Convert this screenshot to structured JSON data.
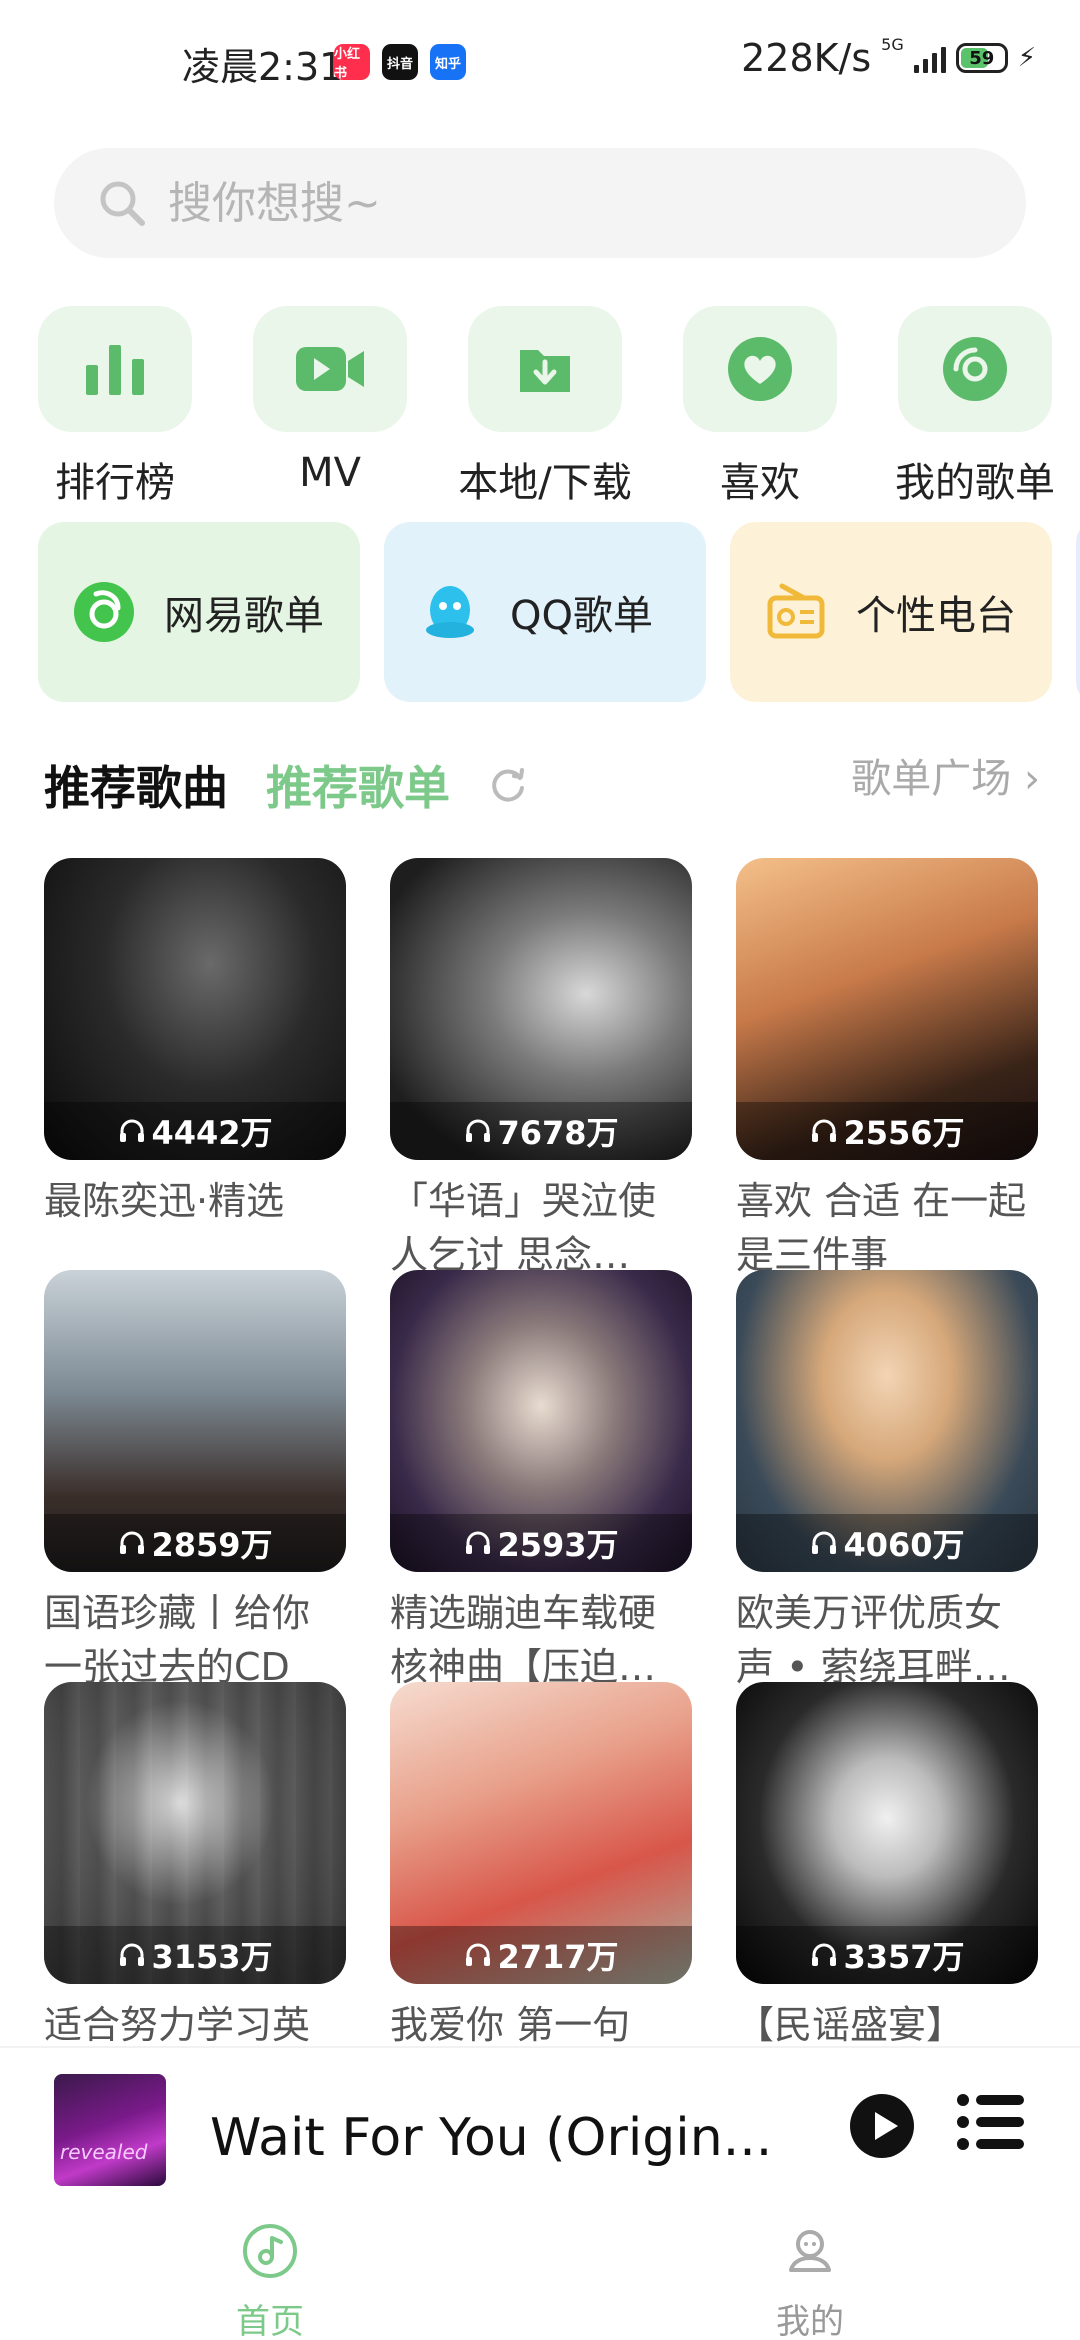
{
  "status_bar": {
    "time": "凌晨2:31",
    "apps": [
      "小红书",
      "抖音",
      "知乎"
    ],
    "speed": "228K/s",
    "network": "5G",
    "battery": "59"
  },
  "search": {
    "placeholder": "搜你想搜~"
  },
  "quick_nav": [
    {
      "label": "排行榜",
      "icon": "chart-icon"
    },
    {
      "label": "MV",
      "icon": "video-icon"
    },
    {
      "label": "本地/下载",
      "icon": "download-folder-icon"
    },
    {
      "label": "喜欢",
      "icon": "heart-icon"
    },
    {
      "label": "我的歌单",
      "icon": "disc-icon"
    }
  ],
  "sources": [
    {
      "label": "网易歌单",
      "icon": "netease-icon"
    },
    {
      "label": "QQ歌单",
      "icon": "qq-icon"
    },
    {
      "label": "个性电台",
      "icon": "radio-icon"
    }
  ],
  "section": {
    "title": "推荐歌曲",
    "tab": "推荐歌单",
    "more": "歌单广场 ›"
  },
  "playlists": [
    {
      "title": "最陈奕迅·精选",
      "plays": "4442万"
    },
    {
      "title": "「华语」哭泣使人乞讨 思念…",
      "plays": "7678万"
    },
    {
      "title": "喜欢 合适 在一起 是三件事",
      "plays": "2556万"
    },
    {
      "title": "国语珍藏丨给你一张过去的CD",
      "plays": "2859万"
    },
    {
      "title": "精选蹦迪车载硬核神曲【压迫…",
      "plays": "2593万"
    },
    {
      "title": "欧美万评优质女声 • 萦绕耳畔…",
      "plays": "4060万"
    },
    {
      "title": "适合努力学习英",
      "plays": "3153万"
    },
    {
      "title": "我爱你  第一句",
      "plays": "2717万"
    },
    {
      "title": "【民谣盛宴】",
      "plays": "3357万"
    }
  ],
  "player": {
    "title": "Wait For You (Origin...",
    "album_text": "revealed"
  },
  "tabs": [
    {
      "label": "首页",
      "active": true
    },
    {
      "label": "我的",
      "active": false
    }
  ],
  "colors": {
    "accent": "#5cbb6a",
    "accent_light": "#eaf6ea",
    "tab_active": "#7cc98a",
    "inactive": "#999999"
  }
}
